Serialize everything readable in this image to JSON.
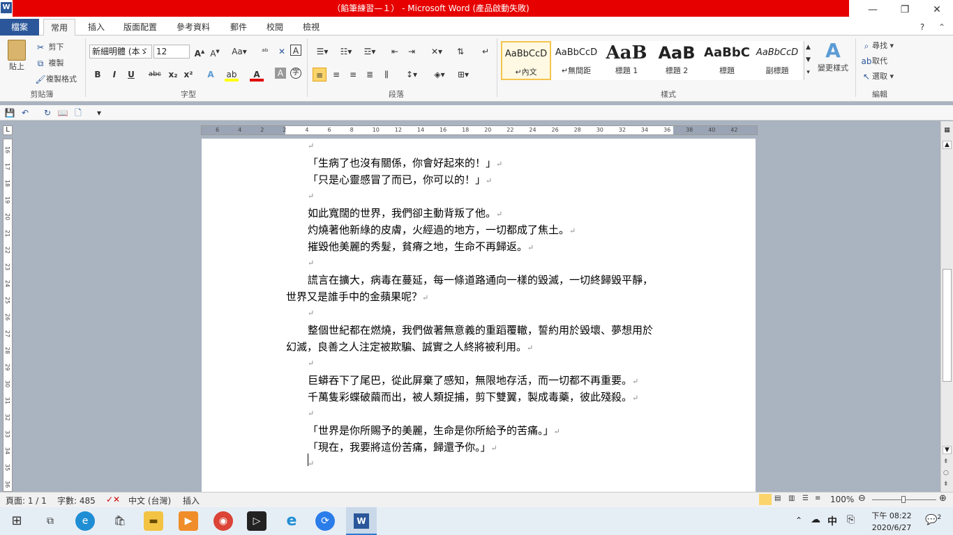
{
  "window": {
    "title": "（餡筆練習—１） - Microsoft Word (產品啟動失敗)",
    "app_icon": "W"
  },
  "tabs": [
    "檔案",
    "常用",
    "插入",
    "版面配置",
    "參考資料",
    "郵件",
    "校閱",
    "檢視"
  ],
  "clipboard": {
    "paste": "貼上",
    "cut": "剪下",
    "copy": "複製",
    "format_painter": "複製格式",
    "label": "剪貼簿"
  },
  "font": {
    "name": "新細明體 (本ゞ",
    "size": "12",
    "label": "字型"
  },
  "paragraph": {
    "label": "段落"
  },
  "styles": {
    "label": "樣式",
    "items": [
      {
        "sample": "AaBbCcD",
        "name": "↵內文"
      },
      {
        "sample": "AaBbCcD",
        "name": "↵無間距"
      },
      {
        "sample": "AaB",
        "name": "標題 1"
      },
      {
        "sample": "AaB",
        "name": "標題 2"
      },
      {
        "sample": "AaBbC",
        "name": "標題"
      },
      {
        "sample": "AaBbCcD",
        "name": "副標題"
      }
    ],
    "change": "變更樣式"
  },
  "editing": {
    "find": "尋找",
    "replace": "取代",
    "select": "選取",
    "label": "編輯"
  },
  "ruler_h": [
    "6",
    "4",
    "2",
    "2",
    "4",
    "6",
    "8",
    "10",
    "12",
    "14",
    "16",
    "18",
    "20",
    "22",
    "24",
    "26",
    "28",
    "30",
    "32",
    "34",
    "36",
    "38",
    "40",
    "42"
  ],
  "ruler_v": [
    "16",
    "17",
    "18",
    "19",
    "20",
    "21",
    "22",
    "23",
    "24",
    "25",
    "26",
    "27",
    "28",
    "29",
    "30",
    "31",
    "32",
    "33",
    "34",
    "35",
    "36"
  ],
  "document": {
    "lines": [
      "",
      "「生病了也沒有關係，你會好起來的！」",
      "「只是心靈感冒了而已，你可以的！」",
      "",
      "如此寬闊的世界，我們卻主動背叛了他。",
      "灼燒著他新綠的皮膚，火經過的地方，一切都成了焦土。",
      "摧毀他美麗的秀髮，貧瘠之地，生命不再歸返。",
      "",
      "謊言在擴大，病毒在蔓延，每一條道路通向一樣的毀滅，一切終歸毀平靜，",
      "世界又是誰手中的金蘋果呢？",
      "",
      "整個世紀都在燃燒，我們做著無意義的重蹈覆轍，誓約用於毀壞、夢想用於",
      "幻滅，良善之人注定被欺騙、誠實之人終將被利用。",
      "",
      "巨蟒吞下了尾巴，從此屏棄了感知，無限地存活，而一切都不再重要。",
      "千萬隻彩蝶破繭而出，被人類捉捕，剪下雙翼，製成毒藥，彼此殘殺。",
      "",
      "「世界是你所賜予的美麗，生命是你所給予的苦痛。」",
      "「現在，我要將這份苦痛，歸還予你。」",
      ""
    ],
    "paragraph_mark": "↵"
  },
  "status": {
    "page": "頁面: 1 / 1",
    "words": "字數: 485",
    "language": "中文 (台灣)",
    "mode": "插入",
    "zoom": "100%"
  },
  "taskbar": {
    "time": "下午 08:22",
    "date": "2020/6/27",
    "ime": "中",
    "notifications": "2"
  }
}
